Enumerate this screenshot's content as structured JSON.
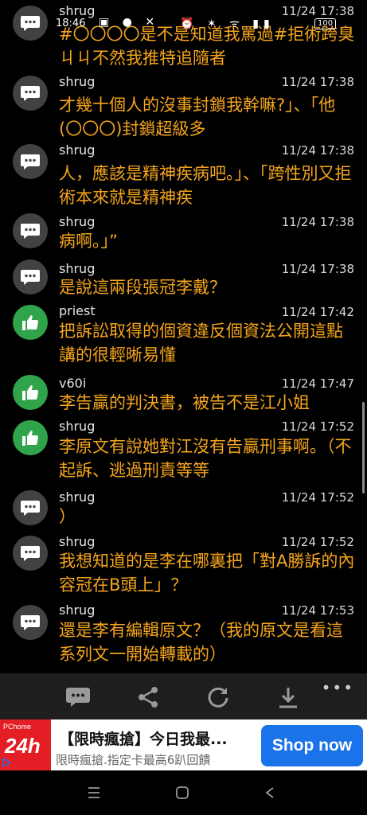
{
  "status_bar": {
    "time": "18:46",
    "icons": [
      "image-icon",
      "messenger-icon",
      "x-icon"
    ],
    "battery": "100"
  },
  "comments": [
    {
      "user": "shrug",
      "time": "11/24 17:38",
      "icon": "speech-bubble-icon",
      "text": "#〇〇〇〇是不是知道我罵過#拒術跨臭ㄐㄐ不然我推特追隨者"
    },
    {
      "user": "shrug",
      "time": "11/24 17:38",
      "icon": "speech-bubble-icon",
      "text": "才幾十個人的沒事封鎖我幹嘛?」、「他(〇〇〇)封鎖超級多"
    },
    {
      "user": "shrug",
      "time": "11/24 17:38",
      "icon": "speech-bubble-icon",
      "text": "人，應該是精神疾病吧。」、「跨性別又拒術本來就是精神疾"
    },
    {
      "user": "shrug",
      "time": "11/24 17:38",
      "icon": "speech-bubble-icon",
      "text": "病啊。」”"
    },
    {
      "user": "shrug",
      "time": "11/24 17:38",
      "icon": "speech-bubble-icon",
      "text": "是說這兩段張冠李戴？"
    },
    {
      "user": "priest",
      "time": "11/24 17:42",
      "icon": "thumbs-up-icon",
      "text": "把訴訟取得的個資違反個資法公開這點講的很輕晰易懂"
    },
    {
      "user": "v60i",
      "time": "11/24 17:47",
      "icon": "thumbs-up-icon",
      "text": "李告贏的判決書，被告不是江小姐"
    },
    {
      "user": "shrug",
      "time": "11/24 17:52",
      "icon": "thumbs-up-icon",
      "text": "李原文有說她對江沒有告贏刑事啊。（不起訴、逃過刑責等等"
    },
    {
      "user": "shrug",
      "time": "11/24 17:52",
      "icon": "speech-bubble-icon",
      "text": "）"
    },
    {
      "user": "shrug",
      "time": "11/24 17:52",
      "icon": "speech-bubble-icon",
      "text": "我想知道的是李在哪裏把「對A勝訴的內容冠在B頭上」？"
    },
    {
      "user": "shrug",
      "time": "11/24 17:53",
      "icon": "speech-bubble-icon",
      "text": "還是李有編輯原文？（我的原文是看這系列文一開始轉載的）"
    }
  ],
  "action_bar": {
    "items": [
      "comment-icon",
      "share-icon",
      "refresh-icon",
      "download-icon"
    ],
    "more": "•••"
  },
  "ad": {
    "logo_top": "PChome",
    "logo_main": "24h",
    "title": "【限時瘋搶】今日我最...",
    "subtitle": "限時瘋搶.指定卡最高6趴回饋",
    "button": "Shop now"
  },
  "nav": [
    "recent-apps-icon",
    "home-icon",
    "back-icon"
  ]
}
